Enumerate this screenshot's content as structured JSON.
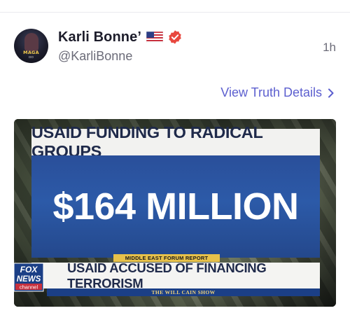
{
  "post": {
    "author_name": "Karli Bonne’",
    "handle": "@KarliBonne",
    "timestamp": "1h",
    "flag_icon": "us-flag-icon",
    "verified_icon": "verified-badge-icon",
    "avatar_text": "MAGA",
    "avatar_subtext": "DO"
  },
  "details_link": {
    "label": "View Truth Details",
    "icon": "chevron-right-icon"
  },
  "media": {
    "headline": "USAID FUNDING TO RADICAL GROUPS",
    "main_figure": "$164 MILLION",
    "source_label": "MIDDLE EAST FORUM REPORT",
    "lower_third": "USAID ACCUSED OF FINANCING TERRORISM",
    "network_logo_top": "FOX",
    "network_logo_mid": "NEWS",
    "network_logo_bottom": "channel",
    "show_name": "THE WILL CAIN SHOW"
  },
  "colors": {
    "link": "#5c5fcf",
    "verified": "#e8483f",
    "panel_blue": "#2c5aa8",
    "headline_text": "#1f2a4a",
    "source_bar": "#e7c14a"
  }
}
